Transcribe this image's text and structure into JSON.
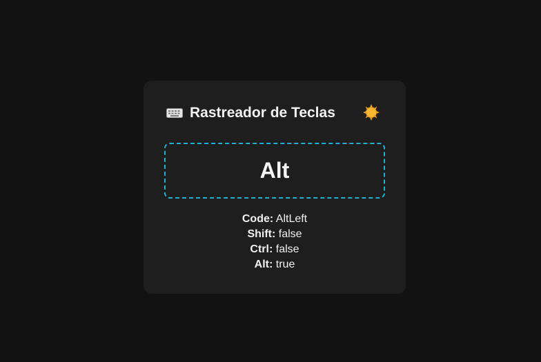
{
  "header": {
    "title": "Rastreador de Teclas",
    "keyboard_icon": "keyboard-icon",
    "theme_icon": "sun-icon"
  },
  "key": {
    "name": "Alt"
  },
  "details": [
    {
      "label": "Code:",
      "value": "AltLeft"
    },
    {
      "label": "Shift:",
      "value": "false"
    },
    {
      "label": "Ctrl:",
      "value": "false"
    },
    {
      "label": "Alt:",
      "value": "true"
    }
  ],
  "colors": {
    "background": "#121212",
    "card": "#1e1e1e",
    "accent_border": "#1fb2d6",
    "sun": "#f5a623"
  }
}
